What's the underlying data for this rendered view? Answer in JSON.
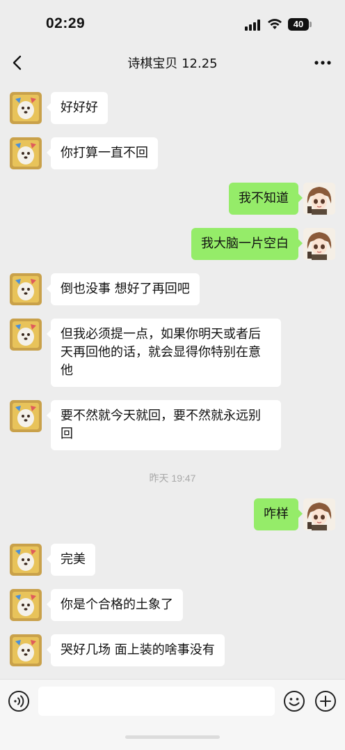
{
  "status_bar": {
    "time": "02:29",
    "battery": "40"
  },
  "nav": {
    "title": "诗棋宝贝 12.25"
  },
  "messages": [
    {
      "side": "left",
      "text": "好好好"
    },
    {
      "side": "left",
      "text": "你打算一直不回"
    },
    {
      "side": "right",
      "text": "我不知道"
    },
    {
      "side": "right",
      "text": "我大脑一片空白"
    },
    {
      "side": "left",
      "text": "倒也没事 想好了再回吧"
    },
    {
      "side": "left",
      "text": "但我必须提一点，如果你明天或者后天再回他的话，就会显得你特别在意他"
    },
    {
      "side": "left",
      "text": "要不然就今天就回，要不然就永远别回"
    },
    {
      "side": "right",
      "text": "咋样"
    },
    {
      "side": "left",
      "text": "完美"
    },
    {
      "side": "left",
      "text": "你是个合格的土象了"
    },
    {
      "side": "left",
      "text": "哭好几场 面上装的啥事没有"
    }
  ],
  "timestamp": "昨天 19:47",
  "input": {
    "value": "",
    "placeholder": ""
  },
  "icons": {
    "back": "chevron-left-icon",
    "more": "more-icon",
    "voice": "voice-icon",
    "emoji": "emoji-icon",
    "plus": "plus-icon"
  },
  "colors": {
    "background": "#ededed",
    "sent_bubble": "#95ec69",
    "received_bubble": "#ffffff",
    "timestamp": "#a8a8a8"
  }
}
